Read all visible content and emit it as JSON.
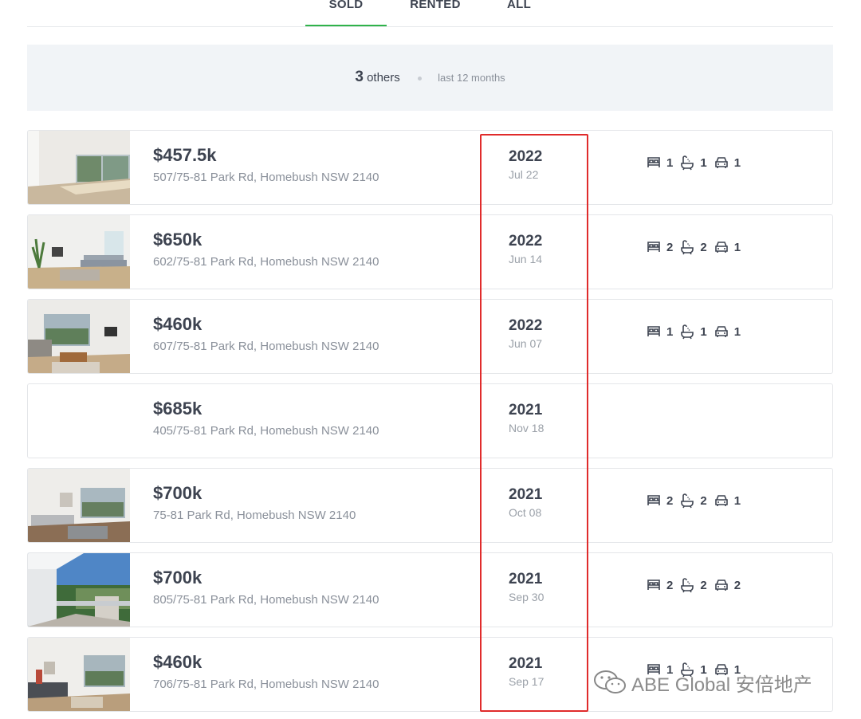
{
  "tabs": [
    {
      "label": "SOLD",
      "active": true
    },
    {
      "label": "RENTED",
      "active": false
    },
    {
      "label": "ALL",
      "active": false
    }
  ],
  "summary": {
    "count": "3",
    "label": "others",
    "period": "last 12 months"
  },
  "listings": [
    {
      "price": "$457.5k",
      "address": "507/75-81 Park Rd, Homebush NSW 2140",
      "year": "2022",
      "date": "Jul 22",
      "has_photo": true,
      "beds": "1",
      "baths": "1",
      "cars": "1"
    },
    {
      "price": "$650k",
      "address": "602/75-81 Park Rd, Homebush NSW 2140",
      "year": "2022",
      "date": "Jun 14",
      "has_photo": true,
      "beds": "2",
      "baths": "2",
      "cars": "1"
    },
    {
      "price": "$460k",
      "address": "607/75-81 Park Rd, Homebush NSW 2140",
      "year": "2022",
      "date": "Jun 07",
      "has_photo": true,
      "beds": "1",
      "baths": "1",
      "cars": "1"
    },
    {
      "price": "$685k",
      "address": "405/75-81 Park Rd, Homebush NSW 2140",
      "year": "2021",
      "date": "Nov 18",
      "has_photo": false
    },
    {
      "price": "$700k",
      "address": "75-81 Park Rd, Homebush NSW 2140",
      "year": "2021",
      "date": "Oct 08",
      "has_photo": true,
      "beds": "2",
      "baths": "2",
      "cars": "1"
    },
    {
      "price": "$700k",
      "address": "805/75-81 Park Rd, Homebush NSW 2140",
      "year": "2021",
      "date": "Sep 30",
      "has_photo": true,
      "beds": "2",
      "baths": "2",
      "cars": "2"
    },
    {
      "price": "$460k",
      "address": "706/75-81 Park Rd, Homebush NSW 2140",
      "year": "2021",
      "date": "Sep 17",
      "has_photo": true,
      "beds": "1",
      "baths": "1",
      "cars": "1"
    }
  ],
  "icons": {
    "bed": "bed-icon",
    "bath": "bath-icon",
    "car": "car-icon"
  },
  "watermark": {
    "text": "ABE Global 安倍地产"
  },
  "colors": {
    "accent": "#2fb34a",
    "highlight": "#e02b2b",
    "text": "#3d4350",
    "muted": "#8a909a",
    "summary_bg": "#f1f4f7"
  }
}
